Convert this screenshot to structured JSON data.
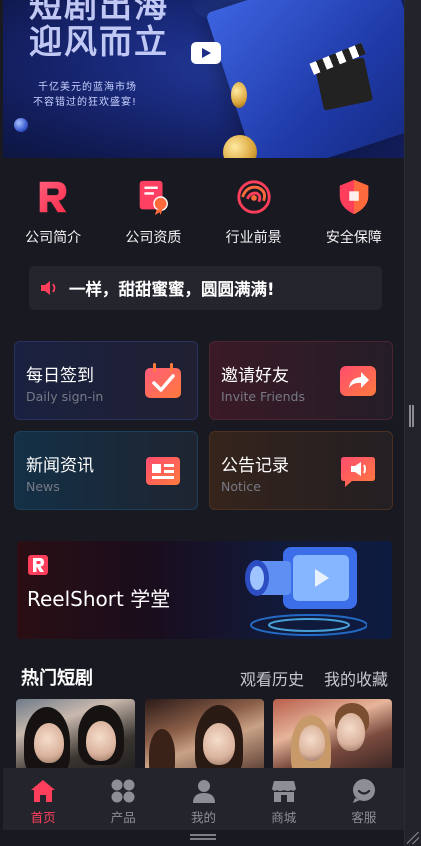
{
  "banner": {
    "title_line1": "短剧出海",
    "title_line2": "迎风而立",
    "sub_line1": "千亿美元的蓝海市场",
    "sub_line2": "不容错过的狂欢盛宴!"
  },
  "features": [
    {
      "label": "公司简介",
      "icon": "company-logo-icon"
    },
    {
      "label": "公司资质",
      "icon": "certificate-icon"
    },
    {
      "label": "行业前景",
      "icon": "swirl-icon"
    },
    {
      "label": "安全保障",
      "icon": "shield-icon"
    }
  ],
  "notice": {
    "text": "一样，甜甜蜜蜜，圆圆满满!"
  },
  "cards": {
    "sign": {
      "title": "每日签到",
      "subtitle": "Daily sign-in"
    },
    "invite": {
      "title": "邀请好友",
      "subtitle": "Invite Friends"
    },
    "news": {
      "title": "新闻资讯",
      "subtitle": "News"
    },
    "notice": {
      "title": "公告记录",
      "subtitle": "Notice"
    }
  },
  "academy": {
    "title": "ReelShort 学堂"
  },
  "hot": {
    "title": "热门短剧",
    "history": "观看历史",
    "favorites": "我的收藏"
  },
  "tabs": [
    {
      "label": "首页",
      "icon": "home-icon",
      "active": true
    },
    {
      "label": "产品",
      "icon": "grid-icon",
      "active": false
    },
    {
      "label": "我的",
      "icon": "user-icon",
      "active": false
    },
    {
      "label": "商城",
      "icon": "store-icon",
      "active": false
    },
    {
      "label": "客服",
      "icon": "chat-icon",
      "active": false
    }
  ],
  "colors": {
    "accent": "#ff3e5c",
    "background": "#191a21",
    "tabbar": "#24252c"
  }
}
